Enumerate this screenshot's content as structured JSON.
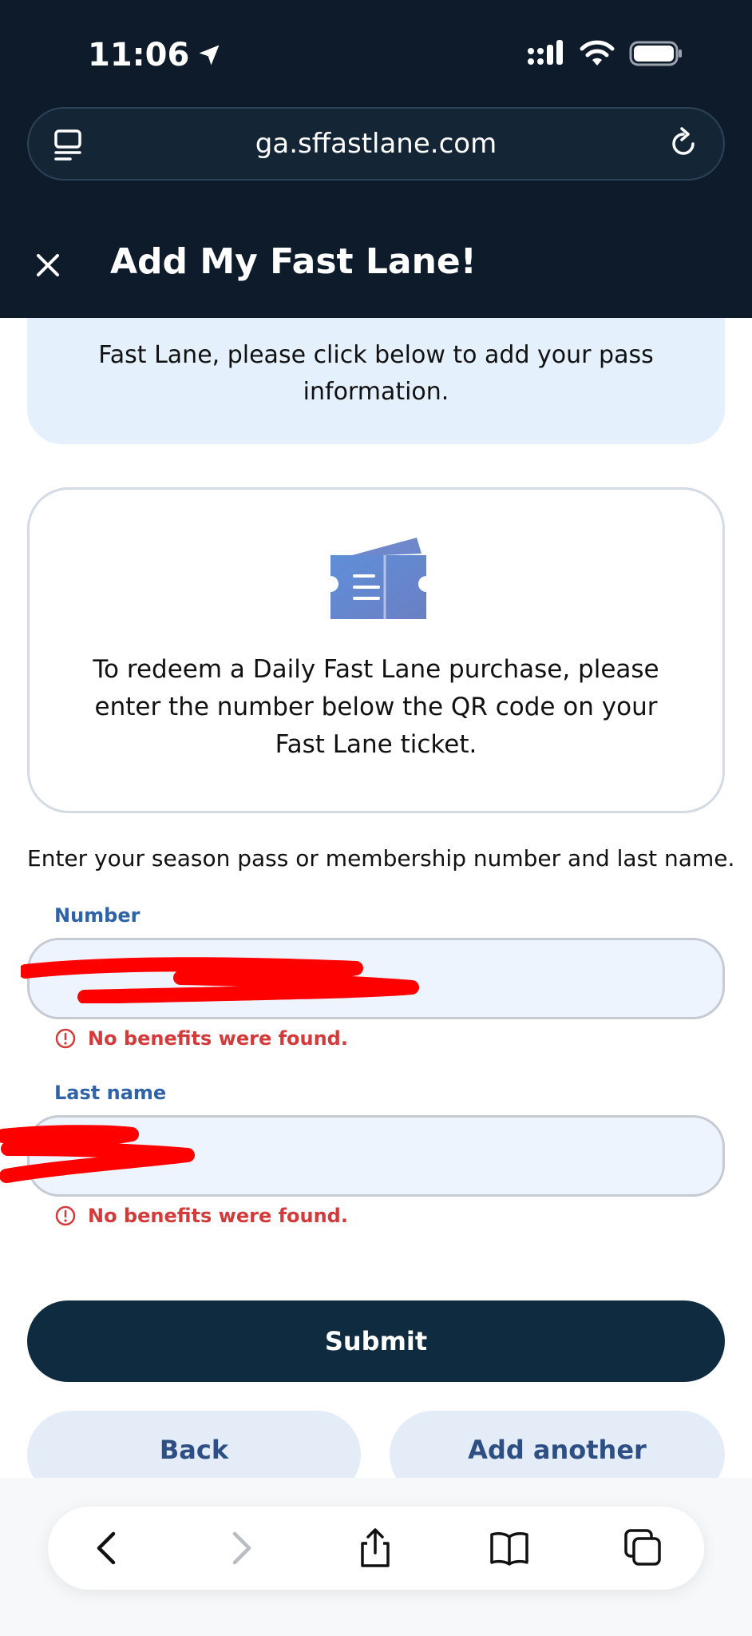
{
  "status_bar": {
    "time": "11:06"
  },
  "browser": {
    "url": "ga.sffastlane.com"
  },
  "header": {
    "title": "Add My Fast Lane!"
  },
  "info_box": {
    "text": "Fast Lane, please click below to add your pass information."
  },
  "ticket_card": {
    "text": "To redeem a Daily Fast Lane purchase, please enter the number below the QR code on your Fast Lane ticket."
  },
  "form": {
    "instructions": "Enter your season pass or membership number and last name.",
    "number_label": "Number",
    "number_error": "No benefits were found.",
    "last_name_label": "Last name",
    "last_name_error": "No benefits were found."
  },
  "buttons": {
    "submit": "Submit",
    "back": "Back",
    "add_another": "Add another"
  },
  "colors": {
    "header_bg": "#0e1b2a",
    "primary_button": "#0f2b40",
    "error": "#d33a3a",
    "label": "#2f63a8",
    "redaction": "#ff0000"
  },
  "icons": {
    "location": "location-arrow-icon",
    "signal": "signal-icon",
    "wifi": "wifi-icon",
    "battery": "battery-icon",
    "tabs_menu": "page-menu-icon",
    "reload": "reload-icon",
    "close": "close-icon",
    "ticket": "ticket-icon",
    "error": "error-circle-icon",
    "back": "chevron-left-icon",
    "forward": "chevron-right-icon",
    "share": "share-icon",
    "bookmarks": "book-icon",
    "tabs": "tabs-icon"
  }
}
